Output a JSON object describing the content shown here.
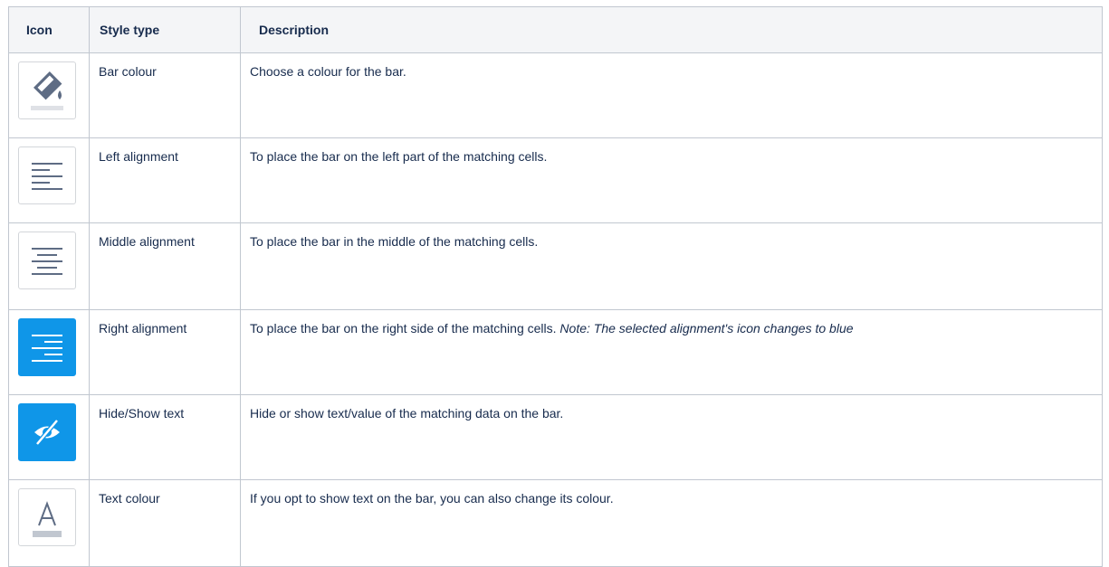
{
  "table": {
    "headers": {
      "icon": "Icon",
      "style_type": "Style type",
      "description": "Description"
    },
    "rows": [
      {
        "icon": "paint-bucket-icon",
        "style_type": "Bar colour",
        "description": "Choose a colour for the bar.",
        "note": ""
      },
      {
        "icon": "align-left-icon",
        "style_type": "Left alignment",
        "description": "To place the bar on the left part of the matching cells.",
        "note": ""
      },
      {
        "icon": "align-center-icon",
        "style_type": "Middle alignment",
        "description": "To place the bar in the middle of the matching cells.",
        "note": ""
      },
      {
        "icon": "align-right-icon",
        "style_type": "Right alignment",
        "description": "To place the bar on the right side of the matching cells. ",
        "note": "Note: The selected alignment's icon changes to blue"
      },
      {
        "icon": "eye-slash-icon",
        "style_type": "Hide/Show text",
        "description": "Hide or show text/value of the matching data on the bar.",
        "note": ""
      },
      {
        "icon": "text-colour-icon",
        "style_type": "Text colour",
        "description": "If you opt to show text on the bar, you can also change its colour.",
        "note": ""
      }
    ]
  },
  "colors": {
    "selected_icon_bg": "#0f96e8",
    "border": "#c1c7d0",
    "header_bg": "#f4f5f7",
    "text": "#172b4d"
  }
}
